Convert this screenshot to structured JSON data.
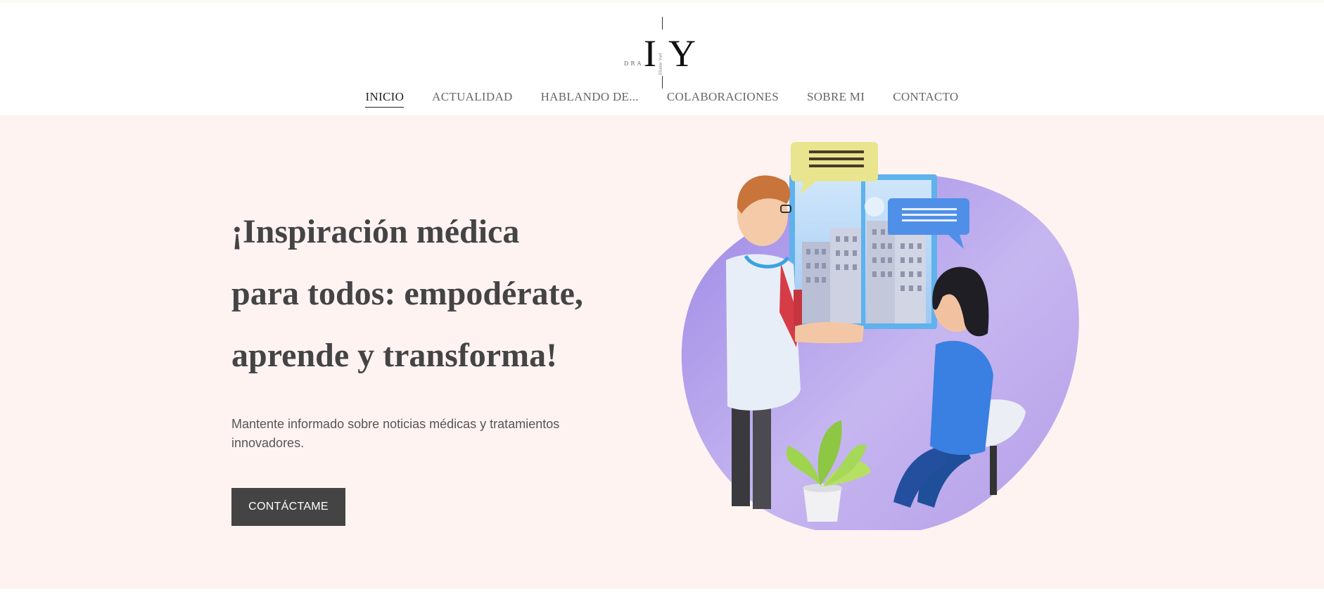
{
  "logo": {
    "prefix": "DRA.",
    "initial_first": "I",
    "initial_last": "Y",
    "vertical_name": "Elianne Vuel",
    "icon": "brand-logo"
  },
  "nav": {
    "items": [
      {
        "label": "INICIO",
        "active": true
      },
      {
        "label": "ACTUALIDAD",
        "active": false
      },
      {
        "label": "HABLANDO DE...",
        "active": false
      },
      {
        "label": "COLABORACIONES",
        "active": false
      },
      {
        "label": "SOBRE MI",
        "active": false
      },
      {
        "label": "CONTACTO",
        "active": false
      }
    ]
  },
  "hero": {
    "title_line1": "¡Inspiración médica",
    "title_line2": "para todos: empodérate,",
    "title_line3": "aprende y transforma!",
    "subtitle": "Mantente informado sobre noticias médicas y tratamientos innovadores.",
    "cta_label": "CONTÁCTAME",
    "illustration": "doctor-consultation-illustration"
  },
  "colors": {
    "hero_bg": "#fff3f2",
    "cta_bg": "#444444",
    "blob": "#b9a6ec",
    "text_dark": "#444444"
  }
}
